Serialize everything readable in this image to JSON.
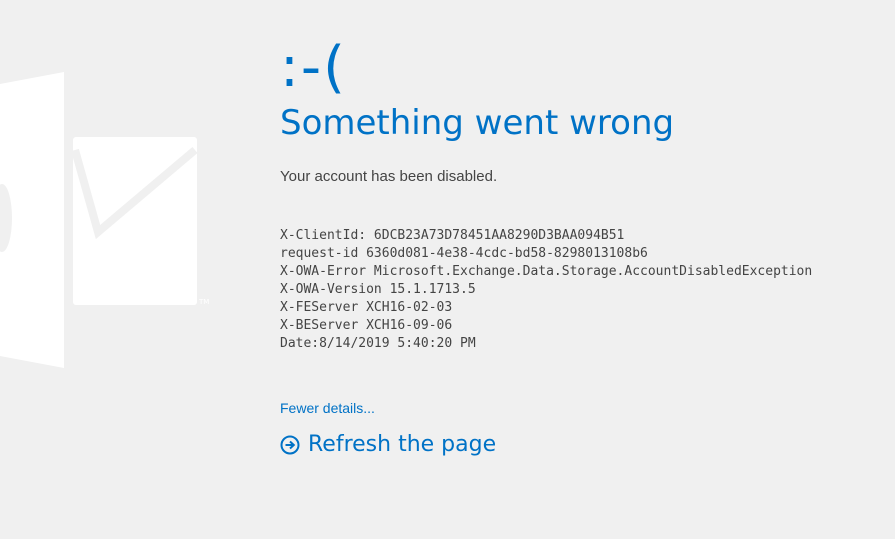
{
  "error": {
    "emoticon": ":-(",
    "title": "Something went wrong",
    "message": "Your account has been disabled."
  },
  "diagnostics": [
    "X-ClientId: 6DCB23A73D78451AA8290D3BAA094B51",
    "request-id 6360d081-4e38-4cdc-bd58-8298013108b6",
    "X-OWA-Error Microsoft.Exchange.Data.Storage.AccountDisabledException",
    "X-OWA-Version 15.1.1713.5",
    "X-FEServer XCH16-02-03",
    "X-BEServer XCH16-09-06",
    "Date:8/14/2019 5:40:20 PM"
  ],
  "links": {
    "fewer_details": "Fewer details...",
    "refresh": "Refresh the page"
  },
  "icons": {
    "background": "outlook-logo-icon",
    "refresh": "arrow-circle-right-icon"
  },
  "colors": {
    "accent": "#0072c6",
    "background": "#f0f0f0",
    "text": "#444444",
    "logo": "#ffffff"
  }
}
